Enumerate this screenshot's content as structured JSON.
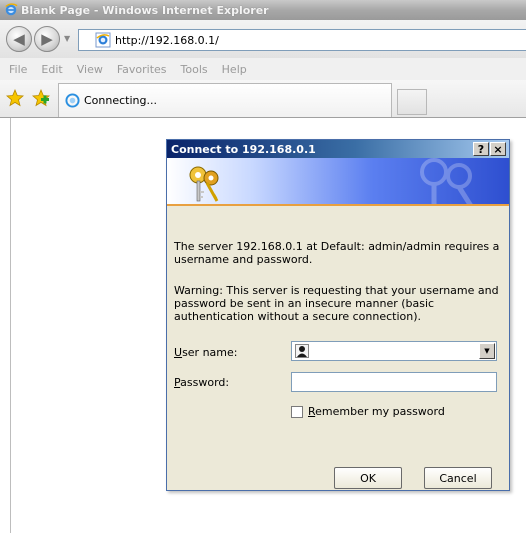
{
  "browser": {
    "window_title": "Blank Page - Windows Internet Explorer",
    "address": "http://192.168.0.1/",
    "menu": [
      "File",
      "Edit",
      "View",
      "Favorites",
      "Tools",
      "Help"
    ],
    "tab_label": "Connecting..."
  },
  "dialog": {
    "title": "Connect to 192.168.0.1",
    "help_label": "?",
    "close_label": "×",
    "message": "The server 192.168.0.1 at Default: admin/admin requires a username and password.",
    "warning": "Warning: This server is requesting that your username and password be sent in an insecure manner (basic authentication without a secure connection).",
    "username_label_key": "U",
    "username_label_rest": "ser name:",
    "username_value": "",
    "password_label_key": "P",
    "password_label_rest": "assword:",
    "password_value": "",
    "remember_key": "R",
    "remember_rest": "emember my password",
    "remember_checked": false,
    "ok_label": "OK",
    "cancel_label": "Cancel"
  }
}
